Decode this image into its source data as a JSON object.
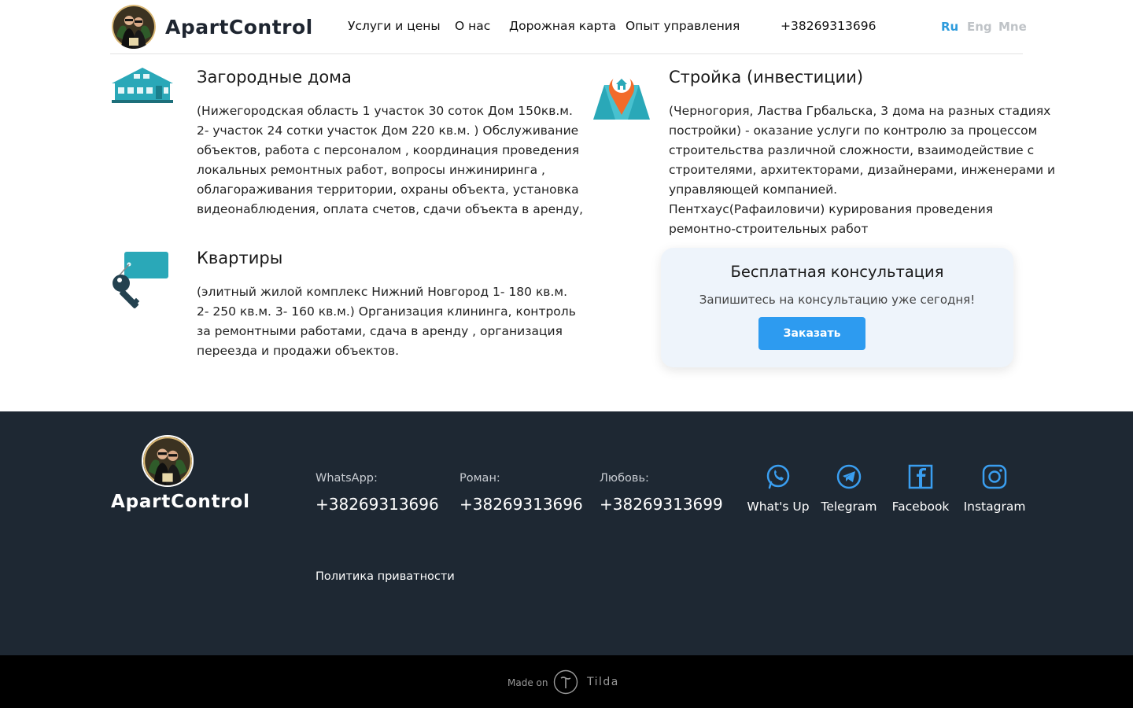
{
  "header": {
    "brand": "ApartControl",
    "nav": [
      "Услуги и цены",
      "О нас",
      "Дорожная карта",
      "Опыт управления"
    ],
    "phone": "+38269313696",
    "languages": [
      {
        "label": "Ru",
        "active": true
      },
      {
        "label": "Eng",
        "active": false
      },
      {
        "label": "Mne",
        "active": false
      }
    ]
  },
  "sections": {
    "country_houses": {
      "icon": "house-icon",
      "title": "Загородные дома",
      "lines": [
        "(Нижегородская область 1 участок 30 соток Дом 150кв.м.",
        "2- участок 24 сотки участок Дом 220 кв.м. ) Обслуживание",
        "объектов, работа с персоналом , координация проведения",
        "локальных ремонтных работ, вопросы инжиниринга ,",
        "облагораживания территории, охраны объекта, установка",
        "видеонаблюдения, оплата счетов, сдачи объекта в аренду,"
      ]
    },
    "construction": {
      "icon": "map-pin-icon",
      "title": "Стройка (инвестиции)",
      "lines": [
        "(Черногория, Ластва Грбальска, 3 дома на разных стадиях",
        "постройки) - оказание услуги по контролю за процессом",
        "строительства различной сложности, взаимодействие с",
        "строителями, архитекторами, дизайнерами, инженерами и",
        "управляющей компанией.",
        "Пентхаус(Рафаиловичи) курирования проведения",
        "ремонтно-строительных работ"
      ]
    },
    "apartments": {
      "icon": "key-tag-icon",
      "title": "Квартиры",
      "lines": [
        "(элитный жилой комплекс Нижний Новгород 1- 180 кв.м.",
        "2- 250 кв.м. 3- 160 кв.м.) Организация клининга, контроль",
        "за ремонтными работами, сдача в аренду , организация",
        "переезда и продажи объектов."
      ]
    }
  },
  "consult": {
    "title": "Бесплатная консультация",
    "subtitle": "Запишитесь на консультацию уже сегодня!",
    "button": "Заказать"
  },
  "footer": {
    "brand": "ApartControl",
    "contacts": [
      {
        "label": "WhatsApp:",
        "number": "+38269313696"
      },
      {
        "label": "Роман:",
        "number": "+38269313696"
      },
      {
        "label": "Любовь:",
        "number": "+38269313699"
      }
    ],
    "socials": [
      {
        "icon": "whatsapp-icon",
        "label": "What's Up"
      },
      {
        "icon": "telegram-icon",
        "label": "Telegram"
      },
      {
        "icon": "facebook-icon",
        "label": "Facebook"
      },
      {
        "icon": "instagram-icon",
        "label": "Instagram"
      }
    ],
    "privacy": "Политика приватности"
  },
  "tilda": {
    "made_on": "Made on",
    "name": "Tilda"
  },
  "colors": {
    "accent": "#2d9bdc",
    "button": "#2d9bf0",
    "teal": "#2aa8b8",
    "footer_bg": "#1e2833"
  }
}
